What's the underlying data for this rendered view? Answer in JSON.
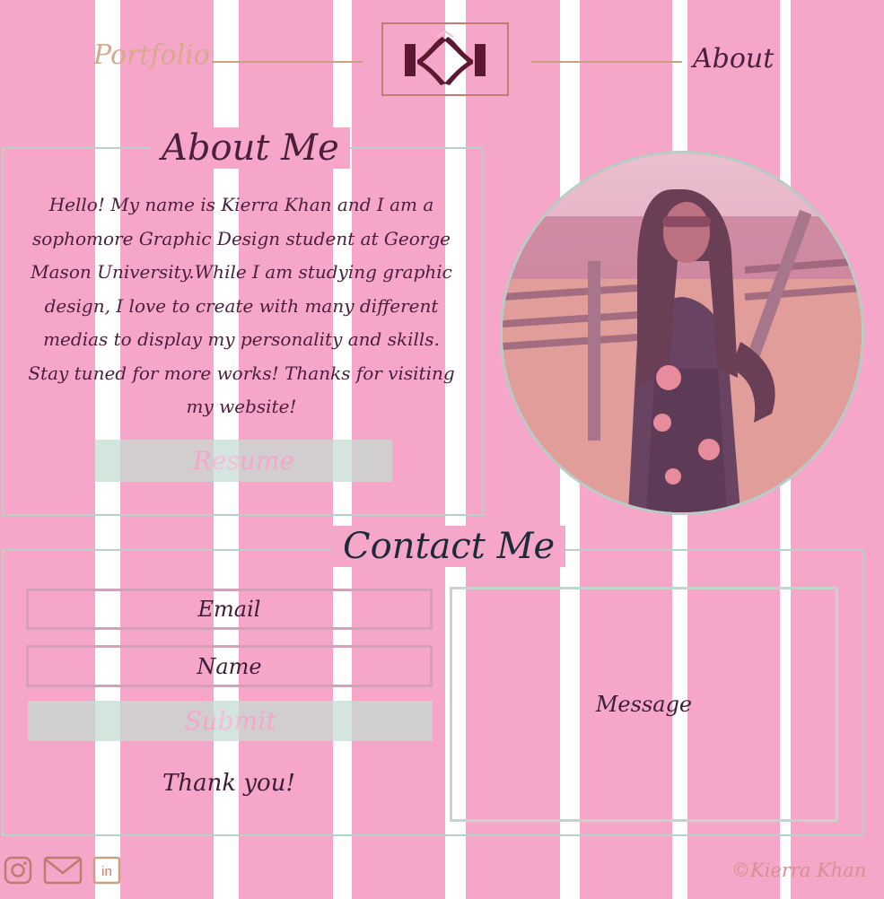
{
  "nav": {
    "left_label": "Portfolio",
    "right_label": "About",
    "logo_text": "KK"
  },
  "about": {
    "heading": "About Me",
    "body": "Hello! My name is Kierra Khan and I am a sophomore Graphic Design student at George Mason University.While I am studying graphic design, I love to create with many different medias to display my personality and skills. Stay tuned for more works! Thanks for visiting my website!",
    "resume_label": "Resume"
  },
  "contact": {
    "heading": "Contact Me",
    "email_placeholder": "Email",
    "name_placeholder": "Name",
    "submit_label": "Submit",
    "thanks": "Thank you!",
    "message_placeholder": "Message"
  },
  "footer": {
    "copyright": "©Kierra Khan",
    "social_icons": [
      "instagram-icon",
      "mail-icon",
      "linkedin-icon"
    ]
  },
  "colors": {
    "column_pink": "#f6a6c9",
    "accent_mint": "#c6dcd3",
    "text_plum": "#4a1f3d",
    "gold": "#c9a084"
  }
}
